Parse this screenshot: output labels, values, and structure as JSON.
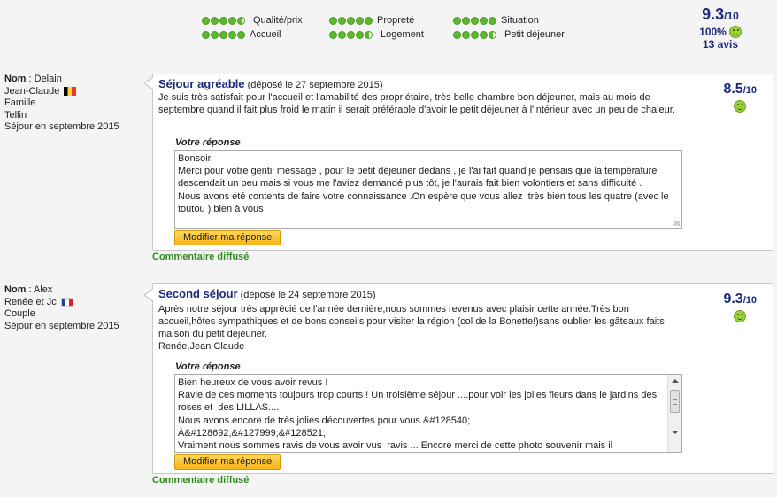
{
  "summary": {
    "criteria": [
      {
        "label": "Qualité/prix",
        "dots": 4.5
      },
      {
        "label": "Accueil",
        "dots": 5
      },
      {
        "label": "Propreté",
        "dots": 5
      },
      {
        "label": "Logement",
        "dots": 4.5
      },
      {
        "label": "Situation",
        "dots": 5
      },
      {
        "label": "Petit déjeuner",
        "dots": 4.5
      }
    ],
    "score": "9.3",
    "score_den": "/10",
    "percent": "100%",
    "count": "13 avis"
  },
  "reviews": [
    {
      "reviewer": {
        "nom_label": "Nom",
        "nom_sep": " : Delain",
        "line2": "Jean-Claude",
        "flag": "belgium",
        "line3": "Famille",
        "line4": "Tellin",
        "line5": "Séjour en septembre 2015"
      },
      "title": "Séjour agréable",
      "posted": " (déposé le 27 septembre 2015)",
      "body": "Je suis très satisfait pour l'accueil et l'amabilité des propriétaire, très belle chambre bon déjeuner, mais au mois de septembre quand il fait plus froid le matin il serait préférable d'avoir le petit déjeuner à l'intérieur avec un peu de chaleur.",
      "score": "8.5",
      "score_den": "/10",
      "response_label": "Votre réponse",
      "response": "Bonsoir,\nMerci pour votre gentil message , pour le petit déjeuner dedans , je l'ai fait quand je pensais que la température descendait un peu mais si vous me l'aviez demandé plus tôt, je l'aurais fait bien volontiers et sans difficulté .\nNous avons été contents de faire votre connaissance .On espère que vous allez  très bien tous les quatre (avec le toutou ) bien à vous",
      "button": "Modifier ma réponse",
      "status": "Commentaire diffusé"
    },
    {
      "reviewer": {
        "nom_label": "Nom",
        "nom_sep": " : Alex",
        "line2": "Renée et Jc",
        "flag": "france",
        "line3": "Couple",
        "line4": "Séjour en septembre 2015"
      },
      "title": "Second séjour",
      "posted": " (déposé le 24 septembre 2015)",
      "body": "Après notre séjour très apprécié de l'année dernière,nous sommes revenus avec plaisir cette année.Très bon accueil,hôtes sympathiques et de bons conseils pour visiter la région (col de la Bonette!)sans oublier les gâteaux faits maison du petit déjeuner.",
      "signature": "Renée,Jean Claude",
      "score": "9.3",
      "score_den": "/10",
      "response_label": "Votre réponse",
      "response": "Bien heureux de vous avoir revus !\nRavie de ces moments toujours trop courts ! Un troisième séjour ....pour voir les jolies fleurs dans le jardins des roses et  des LILLAS....\nNous avons encore de très jolies découvertes pour vous &#128540;\nÀ&#128692;&#127999;&#128521;\nVraiment nous sommes ravis de vous avoir vus  ravis ... Encore merci de cette photo souvenir mais il",
      "button": "Modifier ma réponse",
      "status": "Commentaire diffusé"
    }
  ]
}
